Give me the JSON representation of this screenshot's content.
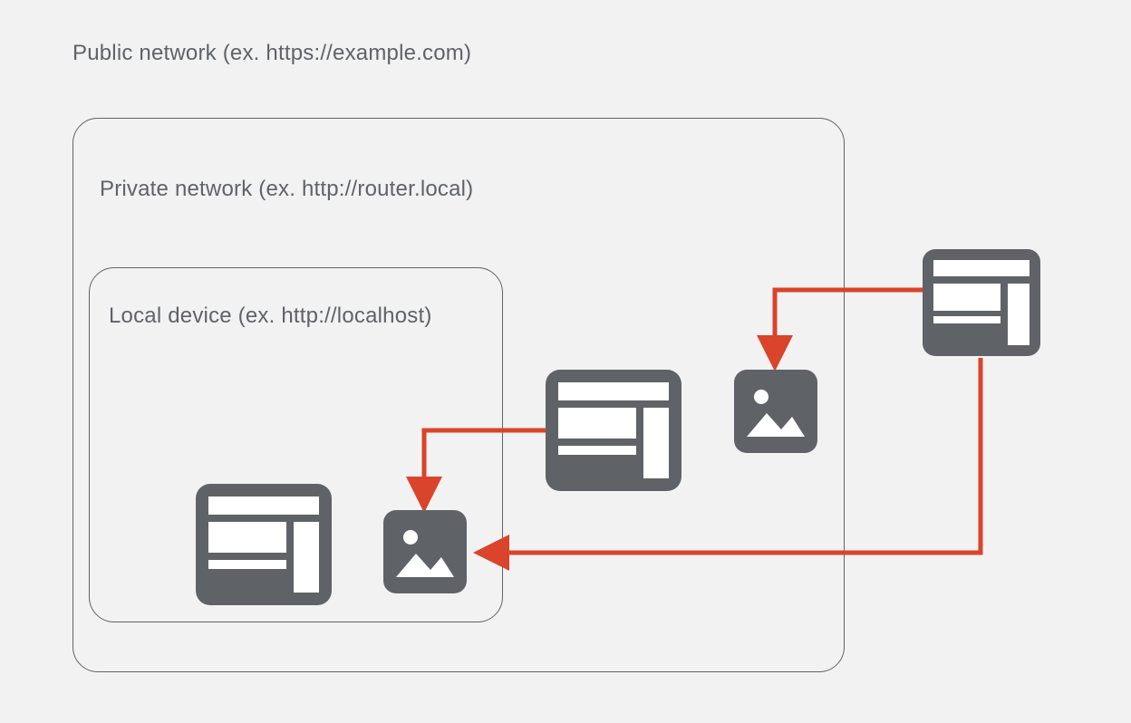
{
  "labels": {
    "public": "Public network (ex. https://example.com)",
    "private": "Private network (ex. http://router.local)",
    "local": "Local device (ex. http://localhost)"
  },
  "icons": {
    "browser_public": "browser-icon",
    "browser_private": "browser-icon",
    "browser_local": "browser-icon",
    "image_private": "image-icon",
    "image_local": "image-icon"
  },
  "colors": {
    "icon_fill": "#5f6368",
    "icon_bg_inner": "#ffffff",
    "arrow": "#d9442b",
    "border": "#5f6368",
    "page_bg": "#f2f2f2"
  },
  "arrows": [
    {
      "from": "browser_public",
      "to": "image_private",
      "desc": "public→private subresource"
    },
    {
      "from": "browser_public",
      "to": "image_local",
      "desc": "public→local subresource"
    },
    {
      "from": "browser_private",
      "to": "image_local",
      "desc": "private→local subresource"
    }
  ]
}
